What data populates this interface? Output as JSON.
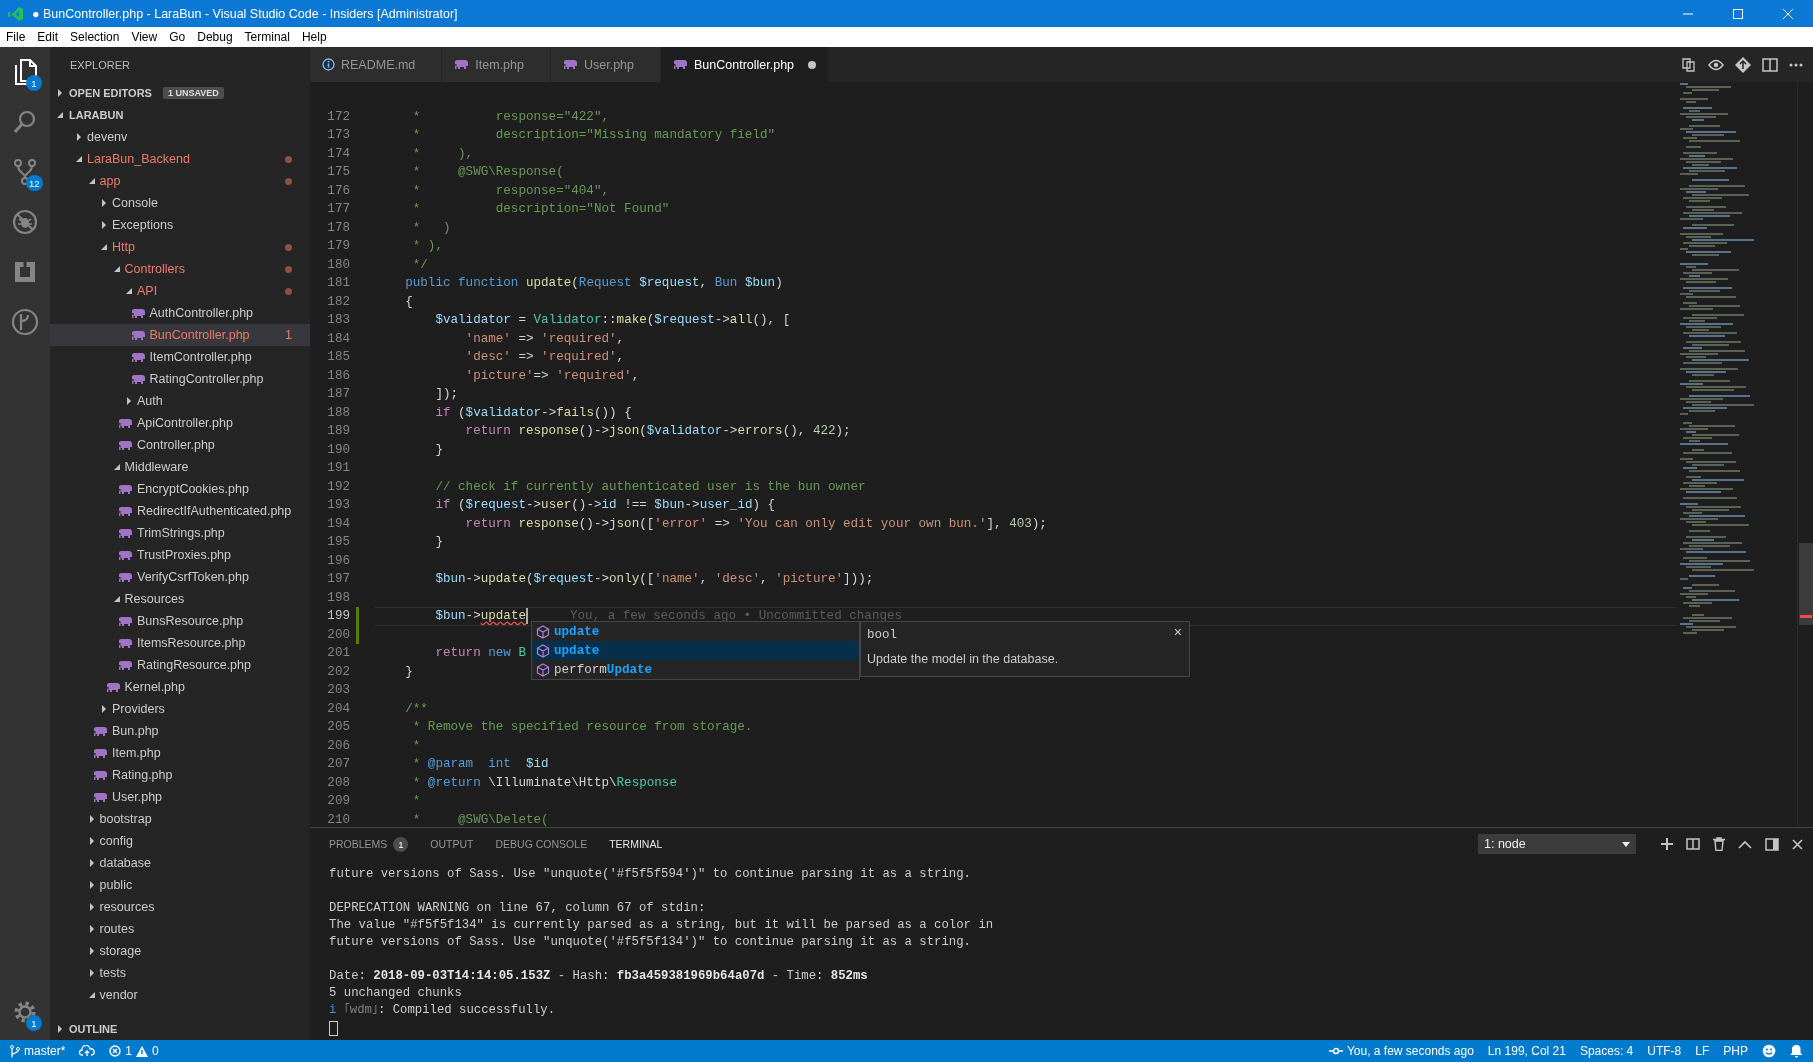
{
  "window": {
    "title": "● BunController.php - LaraBun - Visual Studio Code - Insiders [Administrator]"
  },
  "menu": [
    "File",
    "Edit",
    "Selection",
    "View",
    "Go",
    "Debug",
    "Terminal",
    "Help"
  ],
  "activity_bar": {
    "items": [
      {
        "kind": "files",
        "selected": true,
        "badge": "1"
      },
      {
        "kind": "search",
        "selected": false
      },
      {
        "kind": "source-control",
        "selected": false,
        "badge": "12"
      },
      {
        "kind": "debug",
        "selected": false
      },
      {
        "kind": "extensions",
        "selected": false
      },
      {
        "kind": "git-graph",
        "selected": false
      }
    ],
    "settings_badge": "1"
  },
  "sidebar": {
    "title": "EXPLORER",
    "open_editors": {
      "label": "OPEN EDITORS",
      "badge": "1 UNSAVED",
      "expanded": false
    },
    "project": {
      "label": "LARABUN",
      "expanded": true,
      "tree": [
        {
          "name": "devenv",
          "kind": "folder",
          "expanded": false,
          "modified": false,
          "selected": false
        },
        {
          "name": "LaraBun_Backend",
          "kind": "folder",
          "expanded": true,
          "modified": true,
          "selected": false,
          "children": [
            {
              "name": "app",
              "kind": "folder",
              "expanded": true,
              "modified": true,
              "selected": false,
              "children": [
                {
                  "name": "Console",
                  "kind": "folder",
                  "expanded": false,
                  "modified": false,
                  "selected": false
                },
                {
                  "name": "Exceptions",
                  "kind": "folder",
                  "expanded": false,
                  "modified": false,
                  "selected": false
                },
                {
                  "name": "Http",
                  "kind": "folder",
                  "expanded": true,
                  "modified": true,
                  "selected": false,
                  "children": [
                    {
                      "name": "Controllers",
                      "kind": "folder",
                      "expanded": true,
                      "modified": true,
                      "selected": false,
                      "children": [
                        {
                          "name": "API",
                          "kind": "folder",
                          "expanded": true,
                          "modified": true,
                          "selected": false,
                          "children": [
                            {
                              "name": "AuthController.php",
                              "kind": "file",
                              "modified": false,
                              "selected": false
                            },
                            {
                              "name": "BunController.php",
                              "kind": "file",
                              "modified": true,
                              "selected": true,
                              "problems": "1"
                            },
                            {
                              "name": "ItemController.php",
                              "kind": "file",
                              "modified": false,
                              "selected": false
                            },
                            {
                              "name": "RatingController.php",
                              "kind": "file",
                              "modified": false,
                              "selected": false
                            }
                          ]
                        },
                        {
                          "name": "Auth",
                          "kind": "folder",
                          "expanded": false,
                          "modified": false,
                          "selected": false
                        },
                        {
                          "name": "ApiController.php",
                          "kind": "file",
                          "modified": false,
                          "selected": false
                        },
                        {
                          "name": "Controller.php",
                          "kind": "file",
                          "modified": false,
                          "selected": false
                        }
                      ]
                    },
                    {
                      "name": "Middleware",
                      "kind": "folder",
                      "expanded": true,
                      "modified": false,
                      "selected": false,
                      "children": [
                        {
                          "name": "EncryptCookies.php",
                          "kind": "file",
                          "modified": false,
                          "selected": false
                        },
                        {
                          "name": "RedirectIfAuthenticated.php",
                          "kind": "file",
                          "modified": false,
                          "selected": false
                        },
                        {
                          "name": "TrimStrings.php",
                          "kind": "file",
                          "modified": false,
                          "selected": false
                        },
                        {
                          "name": "TrustProxies.php",
                          "kind": "file",
                          "modified": false,
                          "selected": false
                        },
                        {
                          "name": "VerifyCsrfToken.php",
                          "kind": "file",
                          "modified": false,
                          "selected": false
                        }
                      ]
                    },
                    {
                      "name": "Resources",
                      "kind": "folder",
                      "expanded": true,
                      "modified": false,
                      "selected": false,
                      "children": [
                        {
                          "name": "BunsResource.php",
                          "kind": "file",
                          "modified": false,
                          "selected": false
                        },
                        {
                          "name": "ItemsResource.php",
                          "kind": "file",
                          "modified": false,
                          "selected": false
                        },
                        {
                          "name": "RatingResource.php",
                          "kind": "file",
                          "modified": false,
                          "selected": false
                        }
                      ]
                    },
                    {
                      "name": "Kernel.php",
                      "kind": "file",
                      "modified": false,
                      "selected": false
                    }
                  ]
                },
                {
                  "name": "Providers",
                  "kind": "folder",
                  "expanded": false,
                  "modified": false,
                  "selected": false
                },
                {
                  "name": "Bun.php",
                  "kind": "file",
                  "modified": false,
                  "selected": false
                },
                {
                  "name": "Item.php",
                  "kind": "file",
                  "modified": false,
                  "selected": false
                },
                {
                  "name": "Rating.php",
                  "kind": "file",
                  "modified": false,
                  "selected": false
                },
                {
                  "name": "User.php",
                  "kind": "file",
                  "modified": false,
                  "selected": false
                }
              ]
            },
            {
              "name": "bootstrap",
              "kind": "folder",
              "expanded": false,
              "modified": false,
              "selected": false
            },
            {
              "name": "config",
              "kind": "folder",
              "expanded": false,
              "modified": false,
              "selected": false
            },
            {
              "name": "database",
              "kind": "folder",
              "expanded": false,
              "modified": false,
              "selected": false
            },
            {
              "name": "public",
              "kind": "folder",
              "expanded": false,
              "modified": false,
              "selected": false
            },
            {
              "name": "resources",
              "kind": "folder",
              "expanded": false,
              "modified": false,
              "selected": false
            },
            {
              "name": "routes",
              "kind": "folder",
              "expanded": false,
              "modified": false,
              "selected": false
            },
            {
              "name": "storage",
              "kind": "folder",
              "expanded": false,
              "modified": false,
              "selected": false
            },
            {
              "name": "tests",
              "kind": "folder",
              "expanded": false,
              "modified": false,
              "selected": false
            },
            {
              "name": "vendor",
              "kind": "folder",
              "expanded": true,
              "modified": false,
              "selected": false
            }
          ]
        }
      ]
    },
    "outline": {
      "label": "OUTLINE",
      "expanded": false
    }
  },
  "tabs": [
    {
      "label": "README.md",
      "kind": "info",
      "selected": false,
      "dirty": false
    },
    {
      "label": "Item.php",
      "kind": "php",
      "selected": false,
      "dirty": false
    },
    {
      "label": "User.php",
      "kind": "php",
      "selected": false,
      "dirty": false
    },
    {
      "label": "BunController.php",
      "kind": "php",
      "selected": true,
      "dirty": true
    }
  ],
  "editor": {
    "lines": [
      {
        "number": "172",
        "modified": false,
        "current": false,
        "tokens": [
          {
            "kind": "comment",
            "text": "     *          response=\"422\","
          }
        ]
      },
      {
        "number": "173",
        "modified": false,
        "current": false,
        "tokens": [
          {
            "kind": "comment",
            "text": "     *          description=\"Missing mandatory field\""
          }
        ]
      },
      {
        "number": "174",
        "modified": false,
        "current": false,
        "tokens": [
          {
            "kind": "comment",
            "text": "     *     ),"
          }
        ]
      },
      {
        "number": "175",
        "modified": false,
        "current": false,
        "tokens": [
          {
            "kind": "comment",
            "text": "     *     @SWG\\Response("
          }
        ]
      },
      {
        "number": "176",
        "modified": false,
        "current": false,
        "tokens": [
          {
            "kind": "comment",
            "text": "     *          response=\"404\","
          }
        ]
      },
      {
        "number": "177",
        "modified": false,
        "current": false,
        "tokens": [
          {
            "kind": "comment",
            "text": "     *          description=\"Not Found\""
          }
        ]
      },
      {
        "number": "178",
        "modified": false,
        "current": false,
        "tokens": [
          {
            "kind": "comment",
            "text": "     *   )"
          }
        ]
      },
      {
        "number": "179",
        "modified": false,
        "current": false,
        "tokens": [
          {
            "kind": "comment",
            "text": "     * ),"
          }
        ]
      },
      {
        "number": "180",
        "modified": false,
        "current": false,
        "tokens": [
          {
            "kind": "comment",
            "text": "     */"
          }
        ]
      },
      {
        "number": "181",
        "modified": false,
        "current": false,
        "tokens": [
          {
            "kind": "keyword",
            "text": "    public"
          },
          {
            "kind": "keyword",
            "text": " function"
          },
          {
            "kind": "function",
            "text": " update"
          },
          {
            "kind": "plain",
            "text": "("
          },
          {
            "kind": "class",
            "text": "Request"
          },
          {
            "kind": "variable",
            "text": " $request"
          },
          {
            "kind": "plain",
            "text": ", "
          },
          {
            "kind": "class",
            "text": "Bun"
          },
          {
            "kind": "variable",
            "text": " $bun"
          },
          {
            "kind": "plain",
            "text": ")"
          }
        ]
      },
      {
        "number": "182",
        "modified": false,
        "current": false,
        "tokens": [
          {
            "kind": "plain",
            "text": "    {"
          }
        ]
      },
      {
        "number": "183",
        "modified": false,
        "current": false,
        "tokens": [
          {
            "kind": "variable",
            "text": "        $validator"
          },
          {
            "kind": "plain",
            "text": " = "
          },
          {
            "kind": "type",
            "text": "Validator"
          },
          {
            "kind": "plain",
            "text": "::"
          },
          {
            "kind": "function",
            "text": "make"
          },
          {
            "kind": "plain",
            "text": "("
          },
          {
            "kind": "variable",
            "text": "$request"
          },
          {
            "kind": "plain",
            "text": "->"
          },
          {
            "kind": "function",
            "text": "all"
          },
          {
            "kind": "plain",
            "text": "(), ["
          }
        ]
      },
      {
        "number": "184",
        "modified": false,
        "current": false,
        "tokens": [
          {
            "kind": "string",
            "text": "            'name'"
          },
          {
            "kind": "plain",
            "text": " => "
          },
          {
            "kind": "string",
            "text": "'required'"
          },
          {
            "kind": "plain",
            "text": ","
          }
        ]
      },
      {
        "number": "185",
        "modified": false,
        "current": false,
        "tokens": [
          {
            "kind": "string",
            "text": "            'desc'"
          },
          {
            "kind": "plain",
            "text": " => "
          },
          {
            "kind": "string",
            "text": "'required'"
          },
          {
            "kind": "plain",
            "text": ","
          }
        ]
      },
      {
        "number": "186",
        "modified": false,
        "current": false,
        "tokens": [
          {
            "kind": "string",
            "text": "            'picture'"
          },
          {
            "kind": "plain",
            "text": "=> "
          },
          {
            "kind": "string",
            "text": "'required'"
          },
          {
            "kind": "plain",
            "text": ","
          }
        ]
      },
      {
        "number": "187",
        "modified": false,
        "current": false,
        "tokens": [
          {
            "kind": "plain",
            "text": "        ]);"
          }
        ]
      },
      {
        "number": "188",
        "modified": false,
        "current": false,
        "tokens": [
          {
            "kind": "control",
            "text": "        if"
          },
          {
            "kind": "plain",
            "text": " ("
          },
          {
            "kind": "variable",
            "text": "$validator"
          },
          {
            "kind": "plain",
            "text": "->"
          },
          {
            "kind": "function",
            "text": "fails"
          },
          {
            "kind": "plain",
            "text": "()) {"
          }
        ]
      },
      {
        "number": "189",
        "modified": false,
        "current": false,
        "tokens": [
          {
            "kind": "control",
            "text": "            return"
          },
          {
            "kind": "function",
            "text": " response"
          },
          {
            "kind": "plain",
            "text": "()->"
          },
          {
            "kind": "function",
            "text": "json"
          },
          {
            "kind": "plain",
            "text": "("
          },
          {
            "kind": "variable",
            "text": "$validator"
          },
          {
            "kind": "plain",
            "text": "->"
          },
          {
            "kind": "function",
            "text": "errors"
          },
          {
            "kind": "plain",
            "text": "(), "
          },
          {
            "kind": "number",
            "text": "422"
          },
          {
            "kind": "plain",
            "text": ");"
          }
        ]
      },
      {
        "number": "190",
        "modified": false,
        "current": false,
        "tokens": [
          {
            "kind": "plain",
            "text": "        }"
          }
        ]
      },
      {
        "number": "191",
        "modified": false,
        "current": false
      },
      {
        "number": "192",
        "modified": false,
        "current": false,
        "tokens": [
          {
            "kind": "comment",
            "text": "        // check if currently authenticated user is the bun owner"
          }
        ]
      },
      {
        "number": "193",
        "modified": false,
        "current": false,
        "tokens": [
          {
            "kind": "control",
            "text": "        if"
          },
          {
            "kind": "plain",
            "text": " ("
          },
          {
            "kind": "variable",
            "text": "$request"
          },
          {
            "kind": "plain",
            "text": "->"
          },
          {
            "kind": "function",
            "text": "user"
          },
          {
            "kind": "plain",
            "text": "()->"
          },
          {
            "kind": "variable",
            "text": "id"
          },
          {
            "kind": "plain",
            "text": " !== "
          },
          {
            "kind": "variable",
            "text": "$bun"
          },
          {
            "kind": "plain",
            "text": "->"
          },
          {
            "kind": "variable",
            "text": "user_id"
          },
          {
            "kind": "plain",
            "text": ") {"
          }
        ]
      },
      {
        "number": "194",
        "modified": false,
        "current": false,
        "tokens": [
          {
            "kind": "control",
            "text": "            return"
          },
          {
            "kind": "function",
            "text": " response"
          },
          {
            "kind": "plain",
            "text": "()->"
          },
          {
            "kind": "function",
            "text": "json"
          },
          {
            "kind": "plain",
            "text": "(["
          },
          {
            "kind": "string",
            "text": "'error'"
          },
          {
            "kind": "plain",
            "text": " => "
          },
          {
            "kind": "string",
            "text": "'You can only edit your own bun.'"
          },
          {
            "kind": "plain",
            "text": "], "
          },
          {
            "kind": "number",
            "text": "403"
          },
          {
            "kind": "plain",
            "text": ");"
          }
        ]
      },
      {
        "number": "195",
        "modified": false,
        "current": false,
        "tokens": [
          {
            "kind": "plain",
            "text": "        }"
          }
        ]
      },
      {
        "number": "196",
        "modified": false,
        "current": false
      },
      {
        "number": "197",
        "modified": false,
        "current": false,
        "tokens": [
          {
            "kind": "variable",
            "text": "        $bun"
          },
          {
            "kind": "plain",
            "text": "->"
          },
          {
            "kind": "function",
            "text": "update"
          },
          {
            "kind": "plain",
            "text": "("
          },
          {
            "kind": "variable",
            "text": "$request"
          },
          {
            "kind": "plain",
            "text": "->"
          },
          {
            "kind": "function",
            "text": "only"
          },
          {
            "kind": "plain",
            "text": "(["
          },
          {
            "kind": "string",
            "text": "'name'"
          },
          {
            "kind": "plain",
            "text": ", "
          },
          {
            "kind": "string",
            "text": "'desc'"
          },
          {
            "kind": "plain",
            "text": ", "
          },
          {
            "kind": "string",
            "text": "'picture'"
          },
          {
            "kind": "plain",
            "text": "]));"
          }
        ]
      },
      {
        "number": "198",
        "modified": false,
        "current": false
      },
      {
        "number": "199",
        "modified": true,
        "current": true,
        "tokens": [
          {
            "kind": "variable",
            "text": "        $bun"
          },
          {
            "kind": "plain",
            "text": "->"
          },
          {
            "kind": "function-error",
            "text": "update"
          }
        ],
        "blame": "You, a few seconds ago • Uncommitted changes"
      },
      {
        "number": "200",
        "modified": true,
        "current": false
      },
      {
        "number": "201",
        "modified": false,
        "current": false,
        "tokens": [
          {
            "kind": "control",
            "text": "        return"
          },
          {
            "kind": "keyword",
            "text": " new"
          },
          {
            "kind": "type",
            "text": " B"
          }
        ]
      },
      {
        "number": "202",
        "modified": false,
        "current": false,
        "tokens": [
          {
            "kind": "plain",
            "text": "    }"
          }
        ]
      },
      {
        "number": "203",
        "modified": false,
        "current": false
      },
      {
        "number": "204",
        "modified": false,
        "current": false,
        "tokens": [
          {
            "kind": "comment",
            "text": "    /**"
          }
        ]
      },
      {
        "number": "205",
        "modified": false,
        "current": false,
        "tokens": [
          {
            "kind": "comment",
            "text": "     * Remove the specified resource from storage."
          }
        ]
      },
      {
        "number": "206",
        "modified": false,
        "current": false,
        "tokens": [
          {
            "kind": "comment",
            "text": "     *"
          }
        ]
      },
      {
        "number": "207",
        "modified": false,
        "current": false,
        "tokens": [
          {
            "kind": "comment",
            "text": "     * "
          },
          {
            "kind": "doctag",
            "text": "@param"
          },
          {
            "kind": "doctag",
            "text": "  int"
          },
          {
            "kind": "variable",
            "text": "  $id"
          }
        ]
      },
      {
        "number": "208",
        "modified": false,
        "current": false,
        "tokens": [
          {
            "kind": "comment",
            "text": "     * "
          },
          {
            "kind": "doctag",
            "text": "@return"
          },
          {
            "kind": "plain",
            "text": " \\Illuminate\\Http\\"
          },
          {
            "kind": "type",
            "text": "Response"
          }
        ]
      },
      {
        "number": "209",
        "modified": false,
        "current": false,
        "tokens": [
          {
            "kind": "comment",
            "text": "     *"
          }
        ]
      },
      {
        "number": "210",
        "modified": false,
        "current": false,
        "tokens": [
          {
            "kind": "comment",
            "text": "     *     @SWG\\Delete("
          }
        ]
      }
    ],
    "suggest": {
      "items": [
        {
          "match": "update",
          "selected": false
        },
        {
          "match": "update",
          "selected": true
        },
        {
          "prefix": "perform",
          "match": "Update",
          "selected": false
        }
      ],
      "detail": {
        "type": "bool",
        "doc": "Update the model in the database.",
        "close": "×"
      }
    }
  },
  "panel": {
    "tabs": [
      {
        "label": "PROBLEMS",
        "badge": "1",
        "selected": false
      },
      {
        "label": "OUTPUT",
        "selected": false
      },
      {
        "label": "DEBUG CONSOLE",
        "selected": false
      },
      {
        "label": "TERMINAL",
        "selected": true
      }
    ],
    "terminal_select": "1: node",
    "lines": [
      {
        "kind": "text",
        "text": "future versions of Sass. Use \"unquote('#f5f5f594')\" to continue parsing it as a string."
      },
      {
        "kind": "blank"
      },
      {
        "kind": "text",
        "text": "DEPRECATION WARNING on line 67, column 67 of stdin:"
      },
      {
        "kind": "text",
        "text": "The value \"#f5f5f134\" is currently parsed as a string, but it will be parsed as a color in"
      },
      {
        "kind": "text",
        "text": "future versions of Sass. Use \"unquote('#f5f5f134')\" to continue parsing it as a string."
      },
      {
        "kind": "blank"
      },
      {
        "kind": "text",
        "text": "Date: **2018-09-03T14:14:05.153Z** - Hash: **fb3a459381969b64a07d** - Time: **852ms**"
      },
      {
        "kind": "text",
        "text": "5 unchanged chunks"
      },
      {
        "kind": "log",
        "level": "i",
        "source": "｢wdm｣",
        "text": ": Compiled successfully."
      },
      {
        "kind": "cursor"
      }
    ]
  },
  "status_bar": {
    "branch": "master*",
    "errors": "1",
    "warnings": "0",
    "blame": "You, a few seconds ago",
    "position": "Ln 199, Col 21",
    "indent": "Spaces: 4",
    "encoding": "UTF-8",
    "eol": "LF",
    "language": "PHP"
  }
}
